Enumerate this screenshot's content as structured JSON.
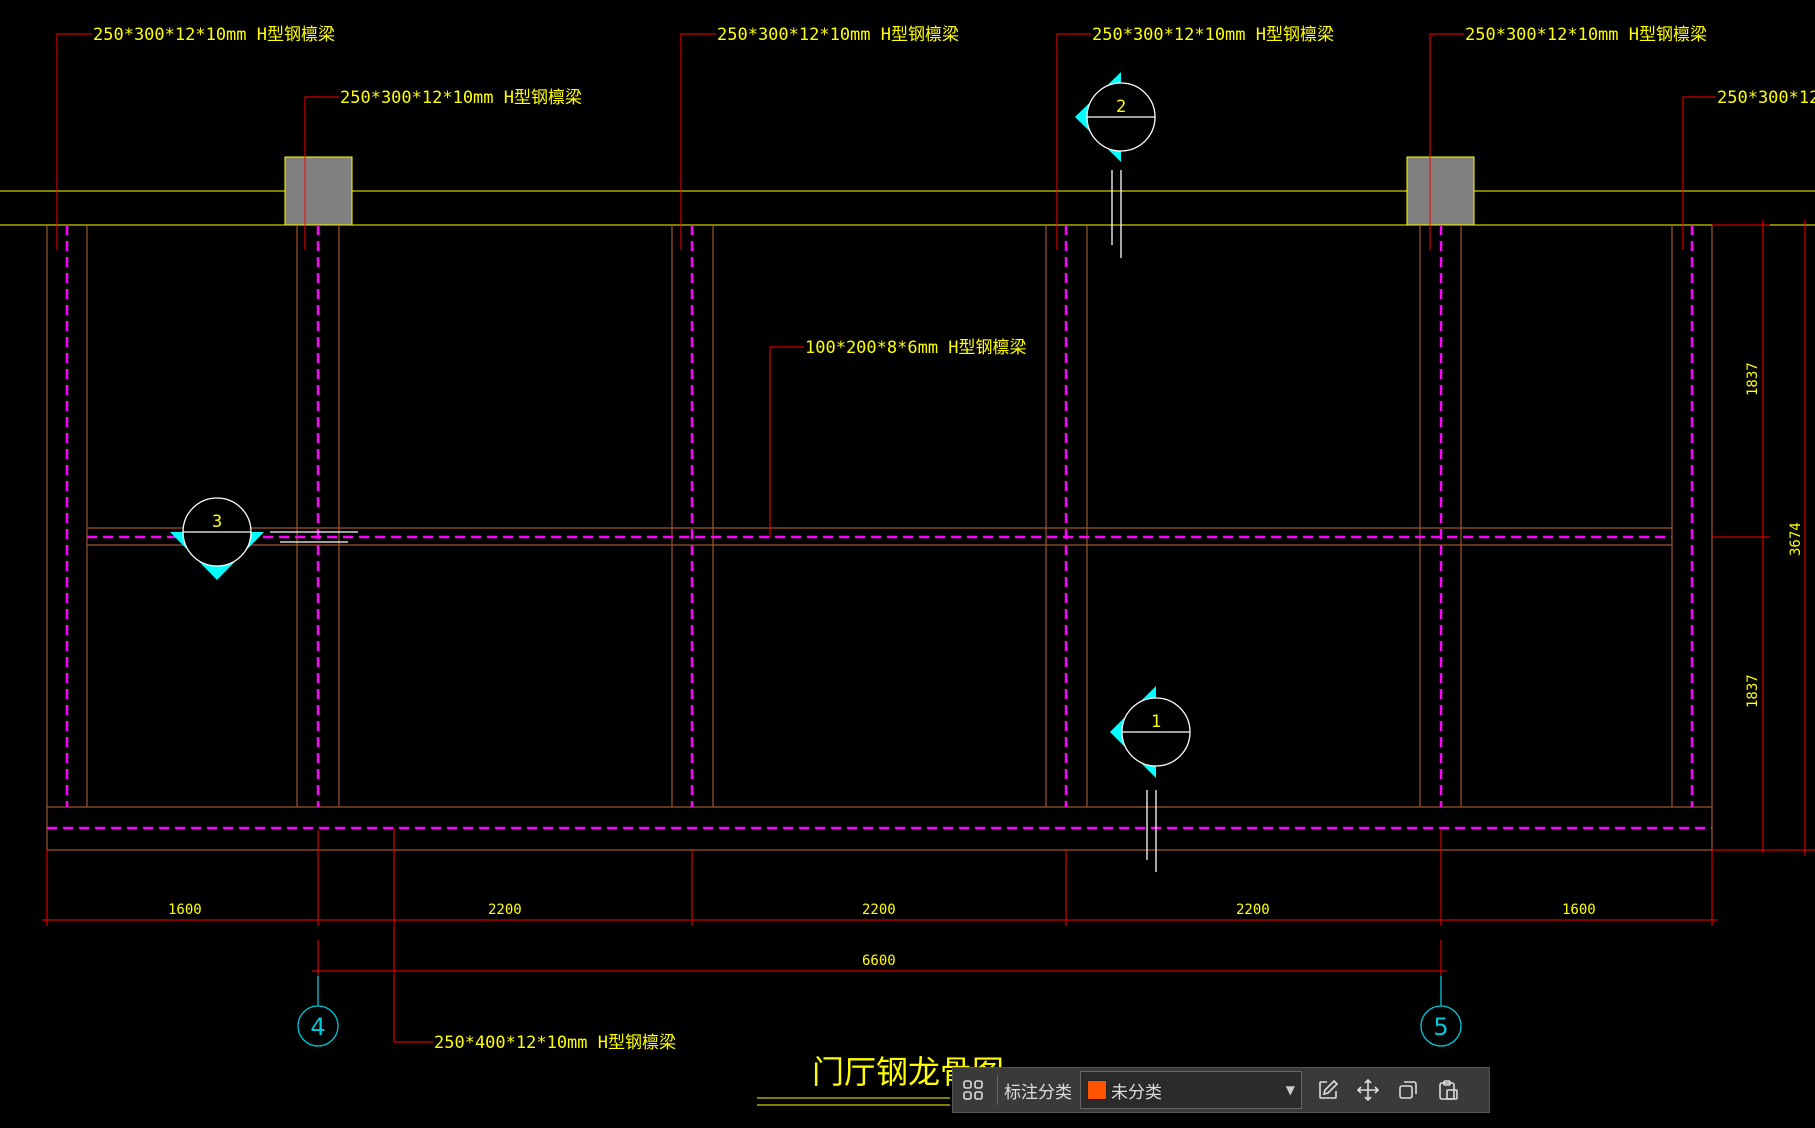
{
  "drawing": {
    "beam_labels": {
      "top_1": "250*300*12*10mm H型钢檩梁",
      "top_2": "250*300*12*10mm H型钢檩梁",
      "top_3": "250*300*12*10mm H型钢檩梁",
      "top_4": "250*300*12*10mm H型钢檩梁",
      "top_5": "250*300*12*10mm H型钢檩梁",
      "top_6": "250*300*12*",
      "mid": "100*200*8*6mm H型钢檩梁",
      "bottom": "250*400*12*10mm H型钢檩梁"
    },
    "section_markers": {
      "s1": "1",
      "s2": "2",
      "s3": "3"
    },
    "dimensions": {
      "d1": "1600",
      "d2": "2200",
      "d3": "2200",
      "d4": "2200",
      "d5": "1600",
      "overall": "6600",
      "v_upper": "1837",
      "v_lower": "1837",
      "v_total": "3674"
    },
    "axis_labels": {
      "a4": "4",
      "a5": "5"
    },
    "title": "门厅钢龙骨图",
    "colors": {
      "yellow": "#ffff00",
      "red": "#ff0000",
      "magenta": "#ff00ff",
      "cyan": "#00ffff",
      "brown": "#a0522d"
    }
  },
  "toolbar": {
    "grid_icon": "grid-icon",
    "label": "标注分类",
    "category_value": "未分类",
    "category_color": "#ff5500",
    "icons": [
      "edit-icon",
      "move-icon",
      "copy-icon",
      "paste-icon"
    ]
  }
}
